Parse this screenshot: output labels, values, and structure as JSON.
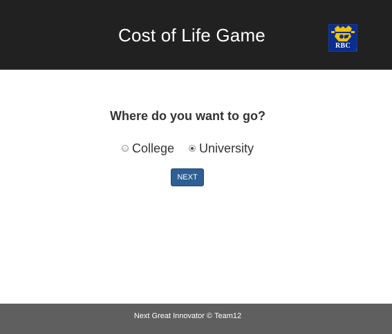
{
  "header": {
    "title": "Cost of Life Game",
    "logo_text": "RBC",
    "logo_tm": "®"
  },
  "main": {
    "question": "Where do you want to go?",
    "options": [
      {
        "label": "College",
        "checked": false
      },
      {
        "label": "University",
        "checked": true
      }
    ],
    "next_label": "NEXT"
  },
  "footer": {
    "text": "Next Great Innovator © Team12"
  },
  "colors": {
    "header_bg": "#212121",
    "button_bg": "#2d5f94",
    "footer_bg": "#5f5f5f",
    "logo_bg": "#0b2d8c",
    "logo_gold": "#f2c300"
  }
}
